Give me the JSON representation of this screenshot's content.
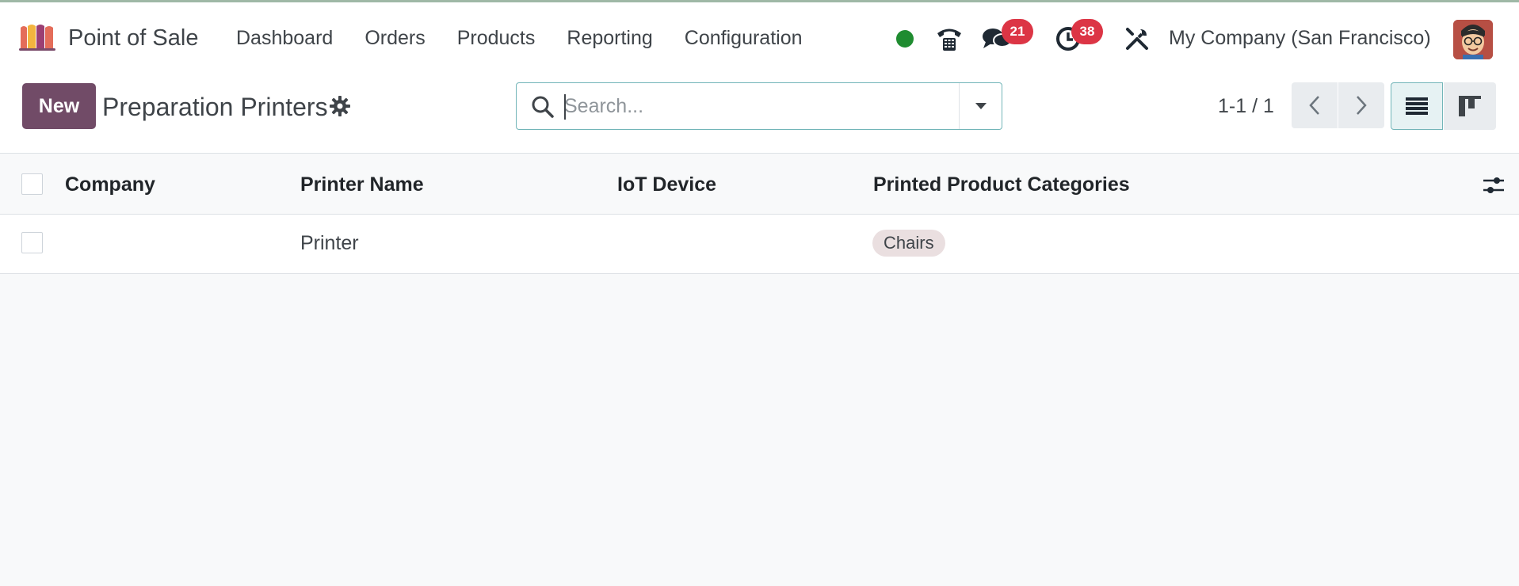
{
  "app": {
    "name": "Point of Sale",
    "logo": "pos-storefront-logo"
  },
  "menu": [
    {
      "label": "Dashboard"
    },
    {
      "label": "Orders"
    },
    {
      "label": "Products"
    },
    {
      "label": "Reporting"
    },
    {
      "label": "Configuration"
    }
  ],
  "systray": {
    "status_color": "#1f8c30",
    "messages_count": "21",
    "activities_count": "38",
    "company": "My Company (San Francisco)"
  },
  "control_panel": {
    "new_label": "New",
    "title": "Preparation Printers",
    "search_placeholder": "Search...",
    "pager": "1-1 / 1"
  },
  "table": {
    "columns": [
      "Company",
      "Printer Name",
      "IoT Device",
      "Printed Product Categories"
    ],
    "rows": [
      {
        "company": "",
        "printer_name": "Printer",
        "iot_device": "",
        "categories": [
          "Chairs"
        ]
      }
    ]
  },
  "colors": {
    "brand": "#714b67",
    "badge": "#dc3545",
    "tag": "#eadfe0",
    "accent_border": "#72b5b8"
  }
}
